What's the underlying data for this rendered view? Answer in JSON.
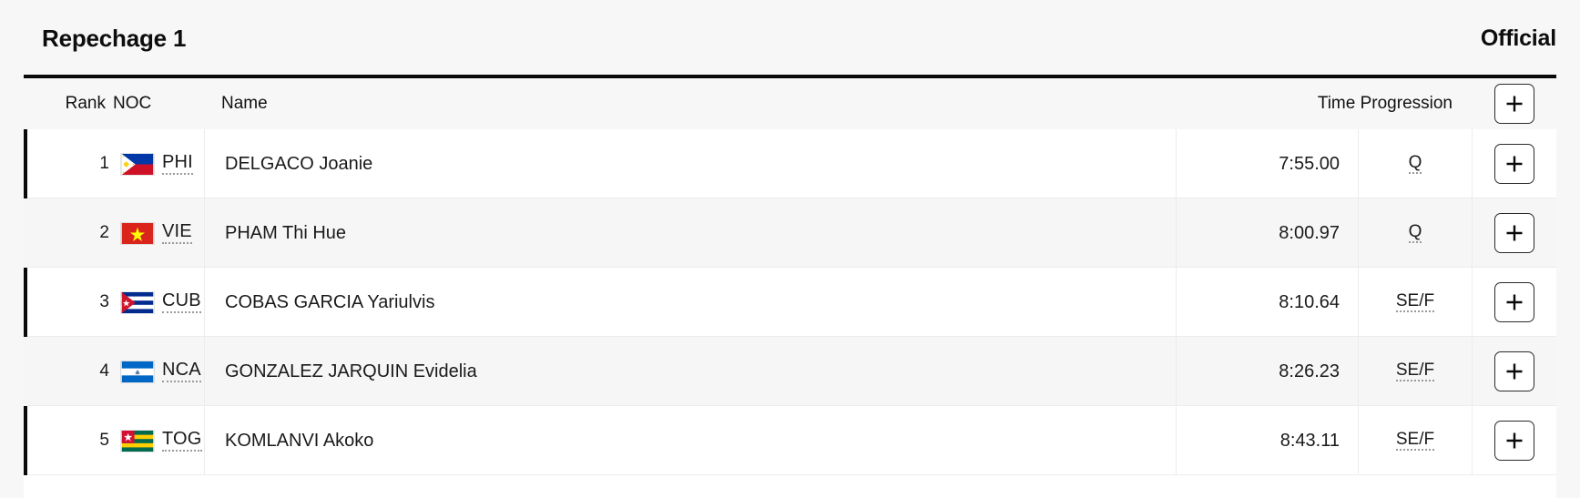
{
  "header": {
    "phase_title": "Repechage 1",
    "status": "Official"
  },
  "table": {
    "columns": {
      "rank": "Rank",
      "noc": "NOC",
      "name": "Name",
      "time": "Time",
      "progression": "Progression",
      "time_progression": "Time Progression",
      "expand": "+"
    },
    "expand_icon": "plus-icon",
    "rows": [
      {
        "rank": "1",
        "noc": "PHI",
        "flag": "philippines-flag",
        "name": "DELGACO Joanie",
        "time": "7:55.00",
        "progression": "Q"
      },
      {
        "rank": "2",
        "noc": "VIE",
        "flag": "vietnam-flag",
        "name": "PHAM Thi Hue",
        "time": "8:00.97",
        "progression": "Q"
      },
      {
        "rank": "3",
        "noc": "CUB",
        "flag": "cuba-flag",
        "name": "COBAS GARCIA Yariulvis",
        "time": "8:10.64",
        "progression": "SE/F"
      },
      {
        "rank": "4",
        "noc": "NCA",
        "flag": "nicaragua-flag",
        "name": "GONZALEZ JARQUIN Evidelia",
        "time": "8:26.23",
        "progression": "SE/F"
      },
      {
        "rank": "5",
        "noc": "TOG",
        "flag": "togo-flag",
        "name": "KOMLANVI Akoko",
        "time": "8:43.11",
        "progression": "SE/F"
      }
    ]
  },
  "colors": {
    "page_background": "#f7f7f7",
    "row_background": "#ffffff",
    "row_alt_background": "#f6f6f6",
    "accent_border": "#0a0a0a",
    "text": "#1a1a1a"
  }
}
